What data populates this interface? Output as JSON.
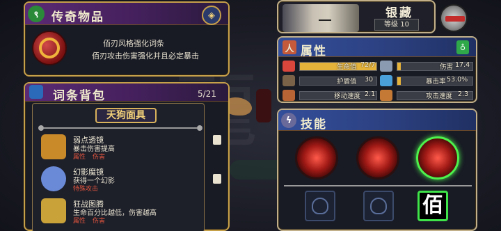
{
  "legendary": {
    "title": "传奇物品",
    "desc_line1": "佰刃风格强化词条",
    "desc_line2": "佰刃攻击伤害强化并且必定暴击"
  },
  "bag": {
    "title": "词条背包",
    "count": "5/21",
    "selected_item": "天狗面具",
    "items": [
      {
        "name": "弱点透镜",
        "effect": "暴击伤害提高",
        "tag1": "属性",
        "tag2": "伤害",
        "color": "#c98a2a"
      },
      {
        "name": "幻影魔镜",
        "effect": "获得一个幻影",
        "tag1": "特殊攻击",
        "tag2": "",
        "color": "#6a8ad8"
      },
      {
        "name": "狂战图腾",
        "effect": "生命百分比越低，伤害越高",
        "tag1": "属性",
        "tag2": "伤害",
        "color": "#c9a23a"
      }
    ]
  },
  "character": {
    "name": "银藏",
    "level_label": "等级 10"
  },
  "attributes": {
    "title": "属性",
    "stats": [
      {
        "label": "生命值",
        "value": "72/7",
        "fill": 1.0,
        "icon_color": "#d8463c"
      },
      {
        "label": "伤害",
        "value": "17.4",
        "fill": 0.05,
        "icon_color": "#8a9ab0"
      },
      {
        "label": "护盾值",
        "value": "30",
        "fill": 0.0,
        "icon_color": "#7a6248"
      },
      {
        "label": "暴击率",
        "value": "53.0%",
        "fill": 0.53,
        "icon_color": "#4aa0d8"
      },
      {
        "label": "移动速度",
        "value": "2.1",
        "fill": 0.0,
        "icon_color": "#b86434"
      },
      {
        "label": "攻击速度",
        "value": "2.3",
        "fill": 0.0,
        "icon_color": "#c47a34"
      }
    ]
  },
  "skills": {
    "title": "技能",
    "active_slot_label": "佰"
  },
  "colors": {
    "gold_border": "#c7a04a",
    "purple_header": "#5b2a74",
    "blue_header": "#334e9a",
    "selected_green": "#4df24d",
    "tag_red": "#e0553e"
  }
}
